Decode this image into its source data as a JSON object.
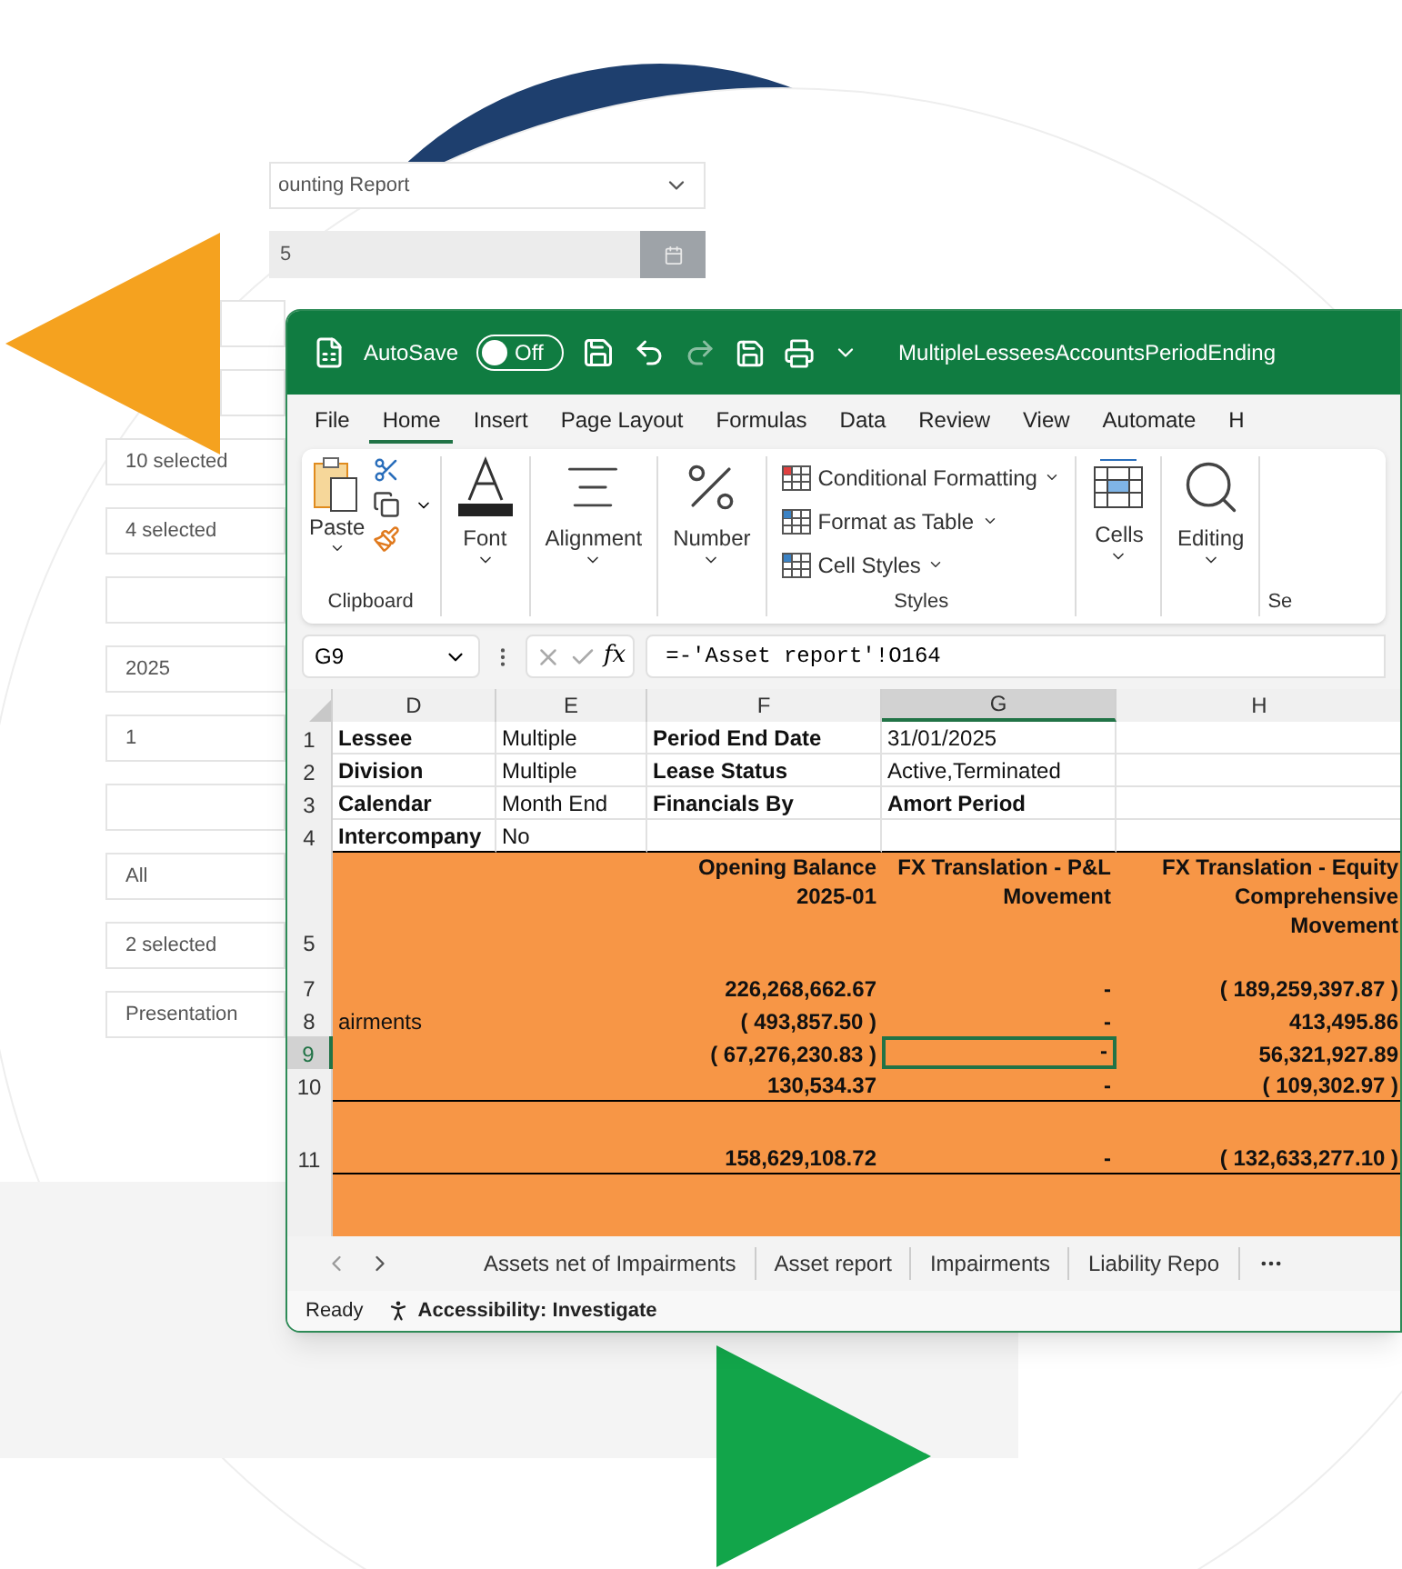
{
  "form": {
    "fields": [
      {
        "kind": "select",
        "value": "ounting Report"
      },
      {
        "kind": "date",
        "value": "5"
      },
      {
        "kind": "stub"
      },
      {
        "kind": "stub"
      },
      {
        "kind": "text",
        "value": "10 selected"
      },
      {
        "kind": "text",
        "value": "4 selected"
      },
      {
        "kind": "text"
      },
      {
        "kind": "text",
        "value": "2025"
      },
      {
        "kind": "text",
        "value": "1"
      },
      {
        "kind": "text"
      },
      {
        "kind": "text",
        "value": "All"
      },
      {
        "kind": "text",
        "value": "2 selected"
      },
      {
        "kind": "text",
        "value": "Presentation"
      }
    ]
  },
  "excel": {
    "titlebar": {
      "autosave": "AutoSave",
      "autosave_toggle": {
        "label": "Off",
        "on": false
      },
      "title": "MultipleLesseesAccountsPeriodEnding"
    },
    "menu_tabs": [
      {
        "label": "File",
        "selected": false
      },
      {
        "label": "Home",
        "selected": true
      },
      {
        "label": "Insert",
        "selected": false
      },
      {
        "label": "Page Layout",
        "selected": false
      },
      {
        "label": "Formulas",
        "selected": false
      },
      {
        "label": "Data",
        "selected": false
      },
      {
        "label": "Review",
        "selected": false
      },
      {
        "label": "View",
        "selected": false
      },
      {
        "label": "Automate",
        "selected": false
      },
      {
        "label": "H",
        "selected": false
      }
    ],
    "ribbon": {
      "groups": [
        {
          "kind": "clipboard",
          "button": "Paste",
          "label": "Clipboard"
        },
        {
          "kind": "font",
          "button": "Font"
        },
        {
          "kind": "alignment",
          "button": "Alignment"
        },
        {
          "kind": "number",
          "button": "Number"
        },
        {
          "kind": "styles",
          "items": [
            "Conditional Formatting",
            "Format as Table",
            "Cell Styles"
          ],
          "label": "Styles"
        },
        {
          "kind": "cells",
          "button": "Cells"
        },
        {
          "kind": "editing",
          "button": "Editing"
        },
        {
          "kind": "partial",
          "label": "Se"
        }
      ]
    },
    "formula_bar": {
      "name_box": "G9",
      "function_label": "fx",
      "formula": "=-'Asset report'!O164"
    },
    "columns": [
      {
        "label": "D",
        "selected": false
      },
      {
        "label": "E",
        "selected": false
      },
      {
        "label": "F",
        "selected": false
      },
      {
        "label": "G",
        "selected": true
      },
      {
        "label": "H",
        "selected": false
      }
    ],
    "rows": [
      {
        "number": "1",
        "kind": "info",
        "selected": false,
        "ruled": false,
        "cells": [
          {
            "text": "Lessee",
            "bold": true
          },
          {
            "text": "Multiple",
            "bold": false
          },
          {
            "text": "Period End Date",
            "bold": true
          },
          {
            "text": "31/01/2025",
            "bold": false
          },
          null
        ]
      },
      {
        "number": "2",
        "kind": "info",
        "selected": false,
        "ruled": false,
        "cells": [
          {
            "text": "Division",
            "bold": true
          },
          {
            "text": "Multiple",
            "bold": false
          },
          {
            "text": "Lease Status",
            "bold": true
          },
          {
            "text": "Active,Terminated",
            "bold": false
          },
          null
        ]
      },
      {
        "number": "3",
        "kind": "info",
        "selected": false,
        "ruled": false,
        "cells": [
          {
            "text": "Calendar",
            "bold": true
          },
          {
            "text": "Month End",
            "bold": false
          },
          {
            "text": "Financials By",
            "bold": true
          },
          {
            "text": "Amort Period",
            "bold": true
          },
          null
        ]
      },
      {
        "number": "4",
        "kind": "info",
        "selected": false,
        "ruled": true,
        "cells": [
          {
            "text": "Intercompany",
            "bold": true
          },
          {
            "text": "No",
            "bold": false
          },
          null,
          null,
          null
        ]
      },
      {
        "number": "5",
        "kind": "header",
        "selected": false,
        "ruled": false,
        "cells": [
          null,
          null,
          {
            "text": "Opening Balance 2025-01",
            "bold": true
          },
          {
            "text": "FX Translation - P&L Movement",
            "bold": true
          },
          {
            "text": "FX Translation - Equity Comprehensive Movement",
            "bold": true
          }
        ]
      },
      {
        "number": "7",
        "kind": "data",
        "selected": false,
        "ruled": false,
        "cells": [
          null,
          null,
          {
            "text": "226,268,662.67",
            "bold": true
          },
          {
            "text": "-",
            "bold": true
          },
          {
            "text": "( 189,259,397.87 )",
            "bold": true
          }
        ]
      },
      {
        "number": "8",
        "kind": "data",
        "selected": false,
        "ruled": false,
        "cells": [
          {
            "text": "airments",
            "bold": false
          },
          null,
          {
            "text": "( 493,857.50 )",
            "bold": true
          },
          {
            "text": "-",
            "bold": true
          },
          {
            "text": "413,495.86",
            "bold": true
          }
        ]
      },
      {
        "number": "9",
        "kind": "data",
        "selected": true,
        "ruled": false,
        "cells": [
          null,
          null,
          {
            "text": "( 67,276,230.83 )",
            "bold": true
          },
          {
            "text": "-",
            "bold": true
          },
          {
            "text": "56,321,927.89",
            "bold": true
          }
        ]
      },
      {
        "number": "10",
        "kind": "data",
        "selected": false,
        "ruled": true,
        "cells": [
          null,
          null,
          {
            "text": "130,534.37",
            "bold": true
          },
          {
            "text": "-",
            "bold": true
          },
          {
            "text": "( 109,302.97 )",
            "bold": true
          }
        ]
      },
      {
        "number": "11",
        "kind": "total",
        "selected": false,
        "ruled": true,
        "cells": [
          null,
          null,
          {
            "text": "158,629,108.72",
            "bold": true
          },
          {
            "text": "-",
            "bold": true
          },
          {
            "text": "( 132,633,277.10 )",
            "bold": true
          }
        ]
      }
    ],
    "sheet_tabs": [
      {
        "label": "Assets net of Impairments"
      },
      {
        "label": "Asset report"
      },
      {
        "label": "Impairments"
      },
      {
        "label": "Liability Repo"
      }
    ],
    "status_bar": {
      "ready": "Ready",
      "accessibility": "Accessibility: Investigate"
    }
  }
}
